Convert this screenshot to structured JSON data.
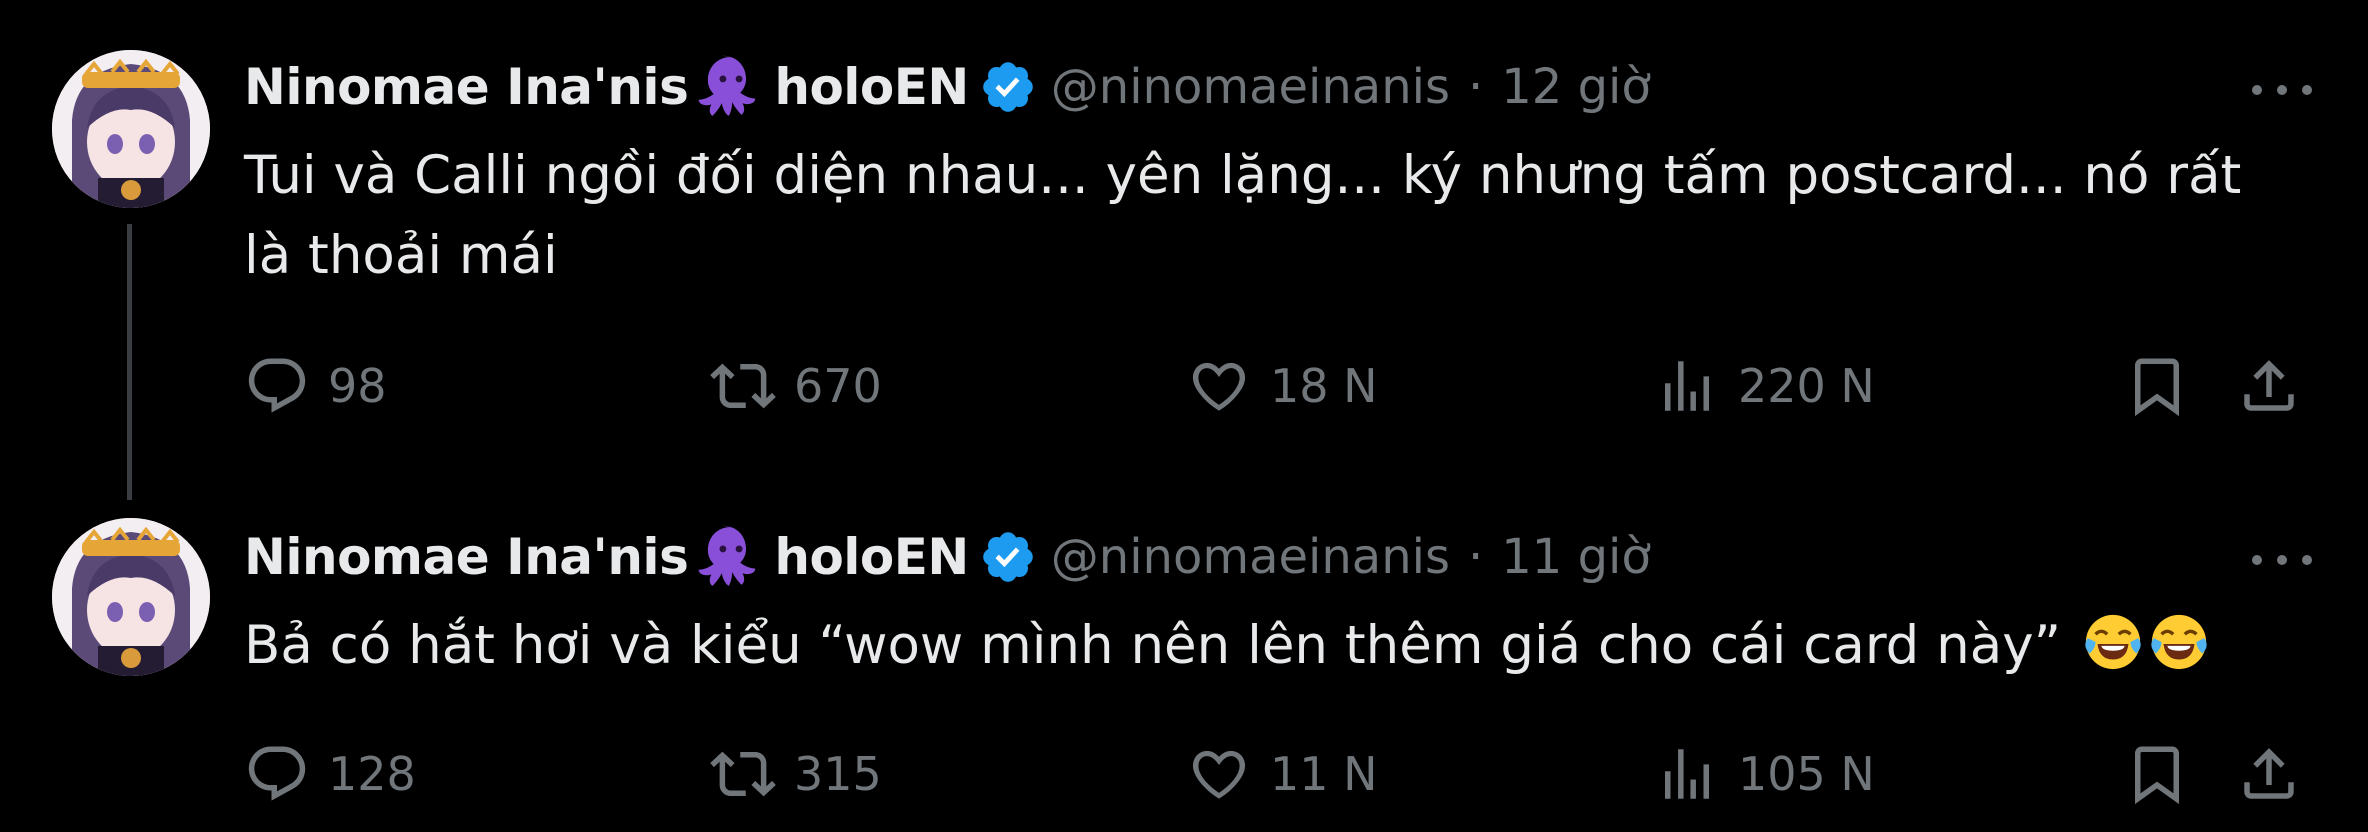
{
  "tweets": [
    {
      "author_name": "Ninomae Ina'nis",
      "author_suffix": "holoEN",
      "handle": "@ninomaeinanis",
      "separator": "·",
      "time": "12 giờ",
      "text": "Tui và Calli ngồi đối diện nhau... yên lặng...  ký nhưng tấm postcard... nó rất là thoải mái",
      "emojis": [],
      "stats": {
        "replies": "98",
        "retweets": "670",
        "likes": "18 N",
        "views": "220 N"
      }
    },
    {
      "author_name": "Ninomae Ina'nis",
      "author_suffix": "holoEN",
      "handle": "@ninomaeinanis",
      "separator": "·",
      "time": "11 giờ",
      "text": "Bả có hắt hơi và kiểu “wow mình nên lên thêm giá cho cái card này”",
      "emojis": [
        "face-with-tears-of-joy",
        "face-with-tears-of-joy"
      ],
      "stats": {
        "replies": "128",
        "retweets": "315",
        "likes": "11 N",
        "views": "105 N"
      }
    }
  ],
  "colors": {
    "background": "#000000",
    "text": "#e7e9ea",
    "muted": "#71767b",
    "verified": "#1d9bf0",
    "octopus": "#8a4fd8"
  },
  "icons": [
    "octopus-emoji",
    "verified-badge-icon",
    "more-icon",
    "reply-icon",
    "retweet-icon",
    "like-icon",
    "views-icon",
    "bookmark-icon",
    "share-icon"
  ]
}
